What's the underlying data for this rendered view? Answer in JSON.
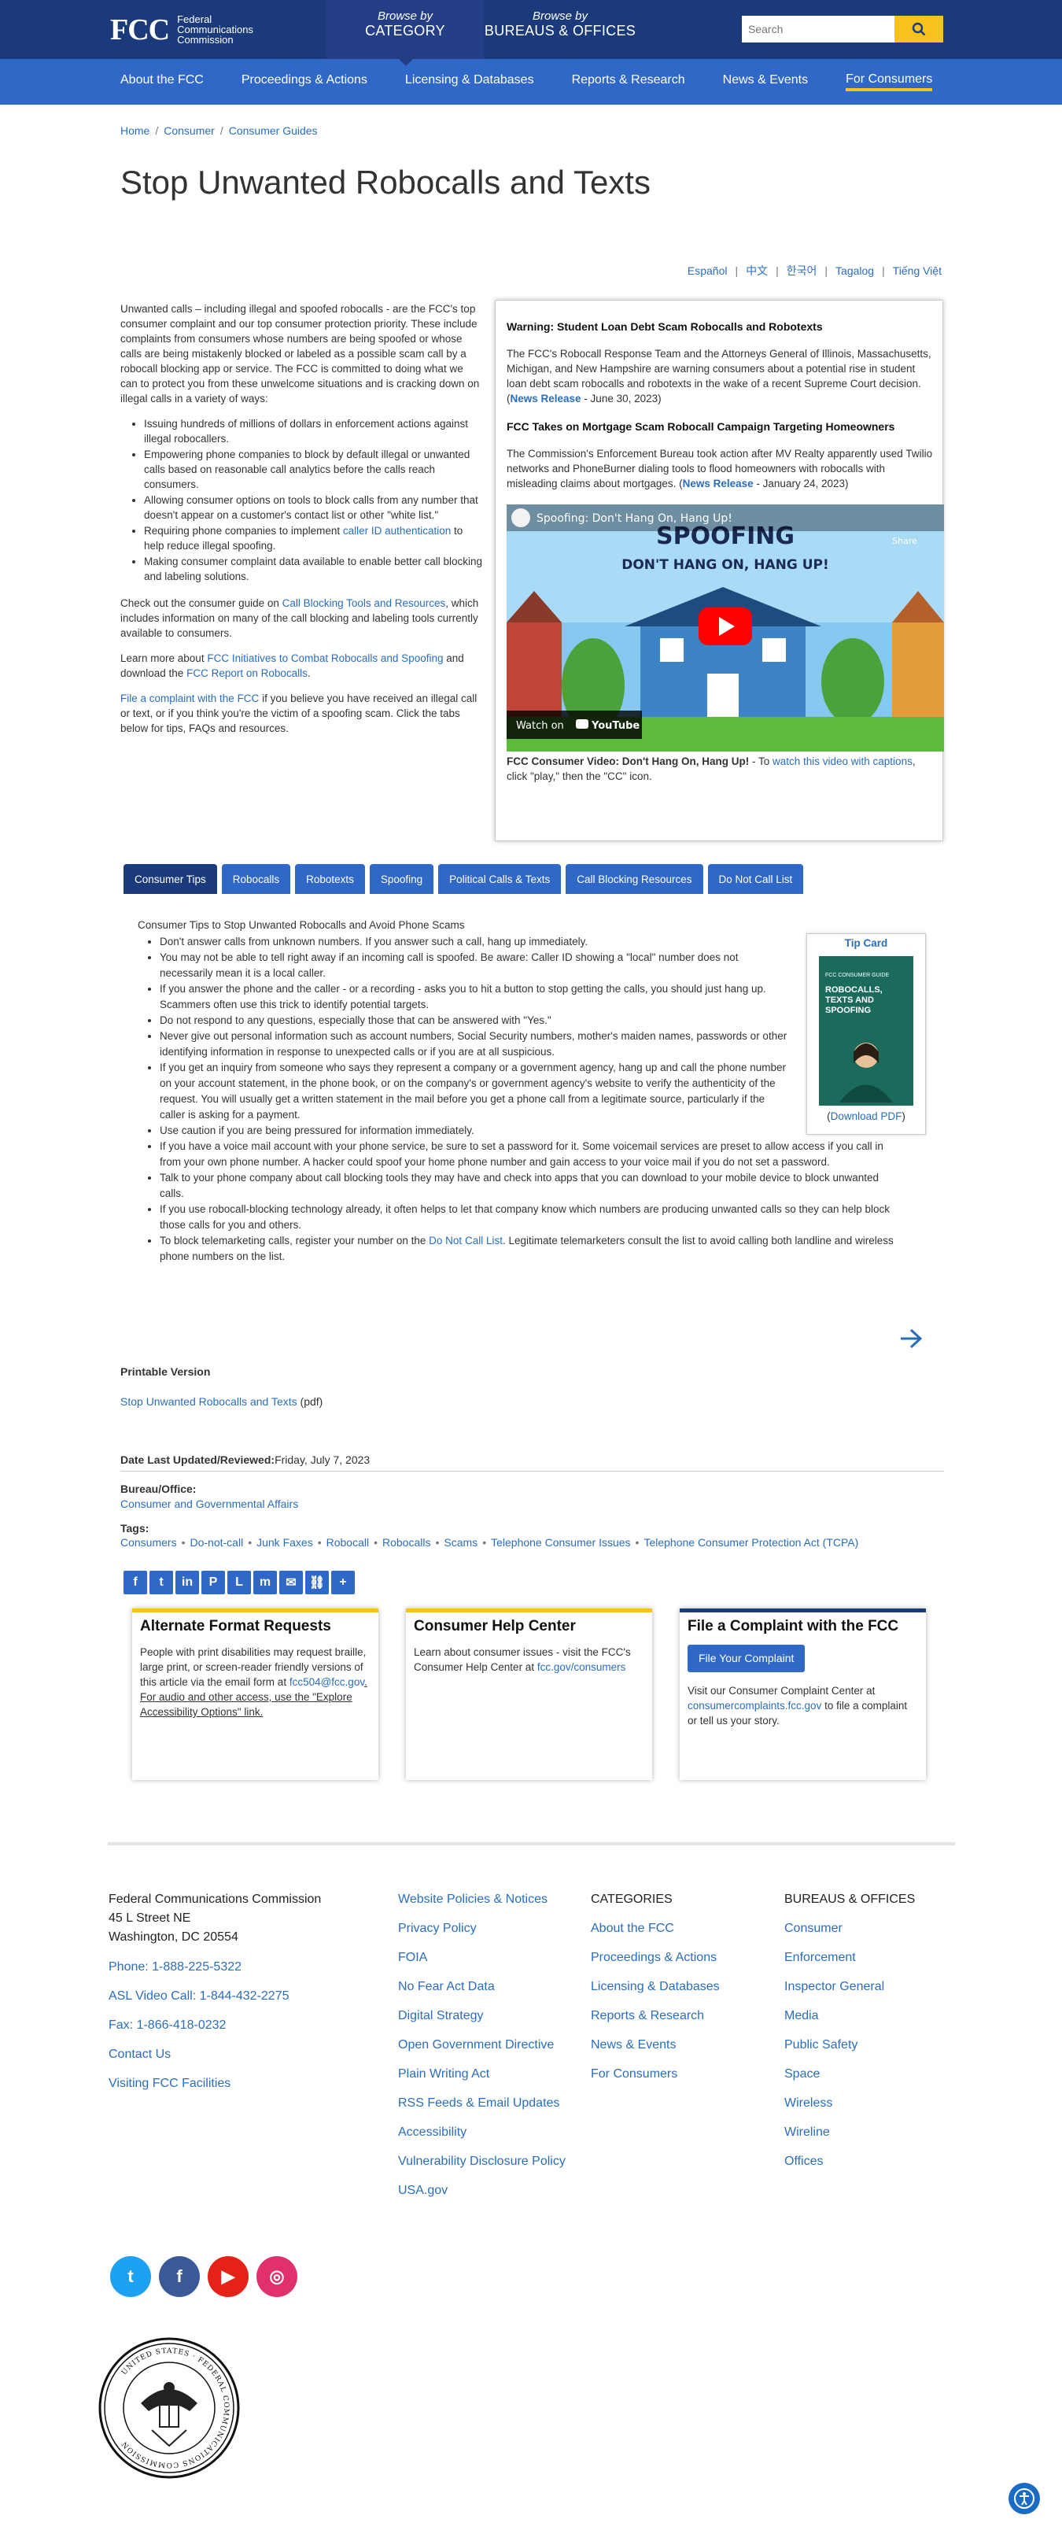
{
  "header": {
    "logo_mark": "FCC",
    "logo_line1": "Federal",
    "logo_line2": "Communications",
    "logo_line3": "Commission",
    "browse_by": "Browse by",
    "browse_category": "CATEGORY",
    "browse_bureaus": "BUREAUS & OFFICES",
    "search_placeholder": "Search"
  },
  "nav": [
    "About the FCC",
    "Proceedings & Actions",
    "Licensing & Databases",
    "Reports & Research",
    "News & Events",
    "For Consumers"
  ],
  "breadcrumb": [
    "Home",
    "Consumer",
    "Consumer Guides"
  ],
  "page_title": "Stop Unwanted Robocalls and Texts",
  "languages": [
    "Español",
    "中文",
    "한국어",
    "Tagalog",
    "Tiếng Việt"
  ],
  "intro": {
    "p1": "Unwanted calls – including illegal and spoofed robocalls - are the FCC's top consumer complaint and our top consumer protection priority. These include complaints from consumers whose numbers are being spoofed or whose calls are being mistakenly blocked or labeled as a possible scam call by a robocall blocking app or service. The FCC is committed to doing what we can to protect you from these unwelcome situations and is cracking down on illegal calls in a variety of ways:",
    "bullets": [
      "Issuing hundreds of millions of dollars in enforcement actions against illegal robocallers.",
      "Empowering phone companies to block by default illegal or unwanted calls based on reasonable call analytics before the calls reach consumers.",
      "Allowing consumer options on tools to block calls from any number that doesn't appear on a customer's contact list or other \"white list.\"",
      "Making consumer complaint data available to enable better call blocking and labeling solutions."
    ],
    "bullet_auth_pre": "Requiring phone companies to implement ",
    "bullet_auth_link": "caller ID authentication",
    "bullet_auth_post": " to help reduce illegal spoofing.",
    "p2_pre": "Check out the consumer guide on ",
    "p2_link": "Call Blocking Tools and Resources",
    "p2_post": ", which includes information on many of the call blocking and labeling tools currently available to consumers.",
    "p3_pre": "Learn more about ",
    "p3_link1": "FCC Initiatives to Combat Robocalls and Spoofing",
    "p3_mid": " and download the ",
    "p3_link2": "FCC Report on Robocalls",
    "p3_post": ".",
    "p4_link": "File a complaint with the FCC",
    "p4_post": " if you believe you have received an illegal call or text, or if you think you're the victim of a spoofing scam. Click the tabs below for tips, FAQs and resources."
  },
  "sidebox": {
    "h1": "Warning: Student Loan Debt Scam Robocalls and Robotexts",
    "p1": "The FCC's Robocall Response Team and the Attorneys General of Illinois, Massachusetts, Michigan, and New Hampshire are warning consumers about a potential rise in student loan debt scam robocalls and robotexts in the wake of a recent Supreme Court decision. (",
    "p1_link": "News Release",
    "p1_post": " - June 30, 2023)",
    "h2": "FCC Takes on Mortgage Scam Robocall Campaign Targeting Homeowners",
    "p2": "The Commission's Enforcement Bureau took action after MV Realty apparently used Twilio networks and PhoneBurner dialing tools to flood homeowners with robocalls with misleading claims about mortgages. (",
    "p2_link": "News Release",
    "p2_post": " - January 24, 2023)",
    "video_title": "Spoofing: Don't Hang On, Hang Up!",
    "video_big": "SPOOFING",
    "video_sub": "DON'T HANG ON, HANG UP!",
    "video_share": "Share",
    "video_watch": "Watch on",
    "video_yt": "YouTube",
    "cap_bold": "FCC Consumer Video: Don't Hang On, Hang Up!",
    "cap_pre": " - To ",
    "cap_link": "watch this video with captions",
    "cap_post": ", click \"play,\" then the \"CC\" icon."
  },
  "tabs": [
    "Consumer Tips",
    "Robocalls",
    "Robotexts",
    "Spoofing",
    "Political Calls & Texts",
    "Call Blocking Resources",
    "Do Not Call List"
  ],
  "tips": {
    "heading": "Consumer Tips to Stop Unwanted Robocalls and Avoid Phone Scams",
    "items": [
      "Don't answer calls from unknown numbers. If you answer such a call, hang up immediately.",
      "You may not be able to tell right away if an incoming call is spoofed. Be aware: Caller ID showing a \"local\" number does not necessarily mean it is a local caller.",
      "If you answer the phone and the caller - or a recording - asks you to hit a button to stop getting the calls, you should just hang up. Scammers often use this trick to identify potential targets.",
      "Do not respond to any questions, especially those that can be answered with \"Yes.\"",
      "Never give out personal information such as account numbers, Social Security numbers, mother's maiden names, passwords or other identifying information in response to unexpected calls or if you are at all suspicious.",
      "If you get an inquiry from someone who says they represent a company or a government agency, hang up and call the phone number on your account statement, in the phone book, or on the company's or government agency's website to verify the authenticity of the request. You will usually get a written statement in the mail before you get a phone call from a legitimate source, particularly if the caller is asking for a payment.",
      "Use caution if you are being pressured for information immediately.",
      "If you have a voice mail account with your phone service, be sure to set a password for it. Some voicemail services are preset to allow access if you call in from your own phone number. A hacker could spoof your home phone number and gain access to your voice mail if you do not set a password.",
      "Talk to your phone company about call blocking tools they may have and check into apps that you can download to your mobile device to block unwanted calls.",
      "If you use robocall-blocking technology already, it often helps to let that company know which numbers are producing unwanted calls so they can help block those calls for you and others."
    ],
    "last_pre": "To block telemarketing calls, register your number on the ",
    "last_link": "Do Not Call List",
    "last_post": ". Legitimate telemarketers consult the list to avoid calling both landline and wireless phone numbers on the list.",
    "tipcard_title": "Tip Card",
    "tipcard_cover_top": "FCC CONSUMER GUIDE",
    "tipcard_cover": "ROBOCALLS, TEXTS AND SPOOFING",
    "tipcard_link": "Download PDF"
  },
  "printable": {
    "heading": "Printable Version",
    "link": "Stop Unwanted Robocalls and Texts",
    "suffix": " (pdf)"
  },
  "meta": {
    "updated_label": "Date Last Updated/Reviewed:",
    "updated_value": "Friday, July 7, 2023",
    "bureau_label": "Bureau/Office:",
    "bureau_value": "Consumer and Governmental Affairs",
    "tags_label": "Tags:",
    "tags": [
      "Consumers",
      "Do-not-call",
      "Junk Faxes",
      "Robocall",
      "Robocalls",
      "Scams",
      "Telephone Consumer Issues",
      "Telephone Consumer Protection Act (TCPA)"
    ]
  },
  "cards": {
    "c1_title": "Alternate Format Requests",
    "c1_text": "People with print disabilities may request braille, large print, or screen-reader friendly versions of this article via the email form at ",
    "c1_link": "fcc504@fcc.gov",
    "c1_post": ". For audio and other access, use the \"Explore Accessibility Options\" link.",
    "c2_title": "Consumer Help Center",
    "c2_text": "Learn about consumer issues - visit the FCC's Consumer Help Center at ",
    "c2_link": "fcc.gov/consumers",
    "c3_title": "File a Complaint with the FCC",
    "c3_button": "File Your Complaint",
    "c3_text": "Visit our Consumer Complaint Center at ",
    "c3_link": "consumercomplaints.fcc.gov",
    "c3_post": " to file a complaint or tell us your story."
  },
  "footer": {
    "org": "Federal Communications Commission",
    "addr1": "45 L Street NE",
    "addr2": "Washington, DC 20554",
    "contacts": [
      "Phone: 1-888-225-5322",
      "ASL Video Call: 1-844-432-2275",
      "Fax: 1-866-418-0232",
      "Contact Us",
      "Visiting FCC Facilities"
    ],
    "col2": [
      "Website Policies & Notices",
      "Privacy Policy",
      "FOIA",
      "No Fear Act Data",
      "Digital Strategy",
      "Open Government Directive",
      "Plain Writing Act",
      "RSS Feeds & Email Updates",
      "Accessibility",
      "Vulnerability Disclosure Policy",
      "USA.gov"
    ],
    "col3_heading": "CATEGORIES",
    "col3": [
      "About the FCC",
      "Proceedings & Actions",
      "Licensing & Databases",
      "Reports & Research",
      "News & Events",
      "For Consumers"
    ],
    "col4_heading": "BUREAUS & OFFICES",
    "col4": [
      "Consumer",
      "Enforcement",
      "Inspector General",
      "Media",
      "Public Safety",
      "Space",
      "Wireless",
      "Wireline",
      "Offices"
    ],
    "seal_text": "UNITED STATES · FEDERAL COMMUNICATIONS COMMISSION"
  },
  "colors": {
    "dark_blue": "#1a3a7c",
    "nav_blue": "#2f68c7",
    "accent_yellow": "#f6c21b",
    "link": "#2a6ebb"
  }
}
